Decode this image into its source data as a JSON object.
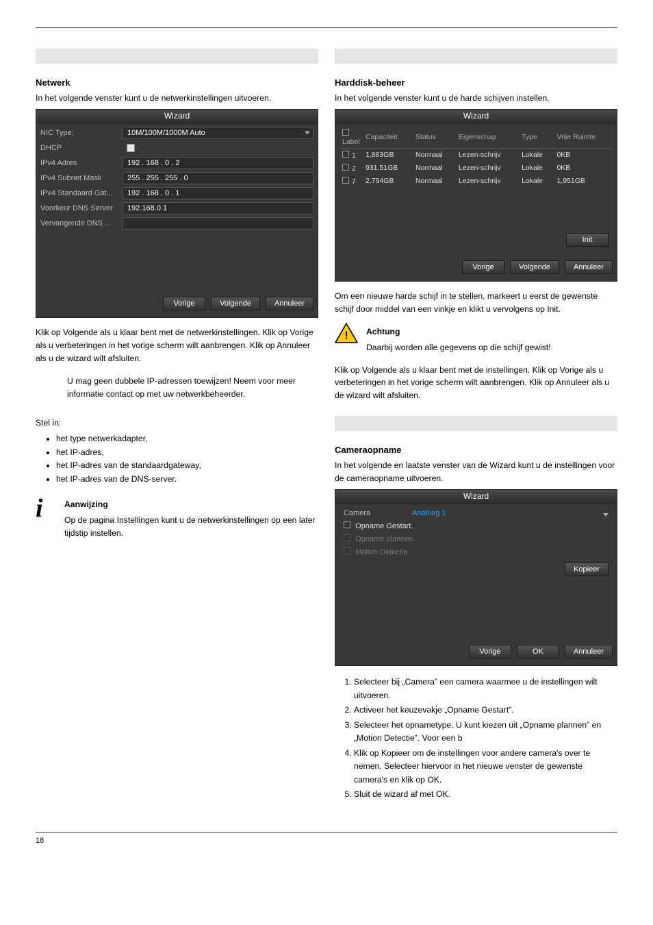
{
  "doc": {
    "section_title": "Netwerk",
    "intro": "In het volgende venster kunt u de netwerkinstellingen uitvoeren.",
    "buttons_para": "Klik op Volgende als u klaar bent met de netwerkinstellingen. Klik op Vorige als u verbeteringen in het vorige scherm wilt aanbrengen. Klik op Annuleer als u de wizard wilt afsluiten.",
    "caution_text": "U mag geen dubbele IP-adressen toewijzen! Neem voor meer informatie contact op met uw netwerkbeheerder.",
    "hdd_section": "Harddisk-beheer",
    "hdd_intro": "In het volgende venster kunt u de harde schijven instellen.",
    "hdd_para": "Om een nieuwe harde schijf in te stellen, markeert u eerst de gewenste schijf door middel van een vinkje en klikt u vervolgens op Init.",
    "hdd_caution": "Daarbij worden alle gegevens op die schijf gewist!",
    "hdd_buttons_para": "Klik op Volgende als u klaar bent met de instellingen. Klik op Vorige als u verbeteringen in het vorige scherm wilt aanbrengen. Klik op Annuleer als u de wizard wilt afsluiten.",
    "nic_label": "NIC Type:",
    "nic_value": "10M/100M/1000M Auto",
    "dhcp_label": "DHCP",
    "ipv4_addr_label": "IPv4 Adres",
    "ipv4_addr_value": "192 . 168 . 0    . 2",
    "ipv4_mask_label": "IPv4 Subnet Mask",
    "ipv4_mask_value": "255 . 255 . 255 . 0",
    "ipv4_gw_label": "IPv4 Standaard Gat...",
    "ipv4_gw_value": "192 . 168 . 0    . 1",
    "dns1_label": "Voorkeur DNS Server",
    "dns1_value": "192.168.0.1",
    "dns2_label": "Vervangende DNS ...",
    "btn_prev": "Vorige",
    "btn_next": "Volgende",
    "btn_cancel": "Annuleer",
    "btn_init": "Init",
    "btn_ok": "OK",
    "btn_kopieer": "Kopieer",
    "wizard_title": "Wizard",
    "hdd_cols": {
      "label": "Label",
      "cap": "Capaciteit",
      "status": "Status",
      "eig": "Eigenschap",
      "type": "Type",
      "vrij": "Vrije Ruimte"
    },
    "hdd_rows": [
      {
        "id": "1",
        "cap": "1,863GB",
        "status": "Normaal",
        "eig": "Lezen-schrijv",
        "type": "Lokale",
        "vrij": "0KB"
      },
      {
        "id": "2",
        "cap": "931.51GB",
        "status": "Normaal",
        "eig": "Lezen-schrijv",
        "type": "Lokale",
        "vrij": "0KB"
      },
      {
        "id": "7",
        "cap": "2,794GB",
        "status": "Normaal",
        "eig": "Lezen-schrijv",
        "type": "Lokale",
        "vrij": "1,951GB"
      }
    ],
    "note_title": "Aanwijzing",
    "note_text": "Op de pagina Instellingen kunt u de netwerkinstellingen op een later tijdstip instellen.",
    "bullets_intro": "Stel in:",
    "bullets": {
      "b0": "het type netwerkadapter,",
      "b1": "het IP-adres,",
      "b2": "het IP-adres van de standaardgateway,",
      "b3": "het IP-adres van de DNS-server."
    },
    "cam_section": "Cameraopname",
    "cam_intro": "In het volgende en laatste venster van de Wizard kunt u de instellingen voor de cameraopname uitvoeren.",
    "rec_camera_label": "Camera",
    "rec_camera_value": "Analoog 1",
    "rec_opname_gestart": "Opname Gestart.",
    "rec_opname_plannen": "Opname plannen",
    "rec_motion": "Motion Detectie",
    "steps": {
      "s1": "Selecteer bij „Camera” een camera waarmee u de instellingen wilt uitvoeren.",
      "s2": "Activeer het keuzevakje „Opname Gestart”.",
      "s3": "Selecteer het opnametype. U kunt kiezen uit „Opname plannen” en „Motion Detectie”. Voor een b",
      "s4": "Klik op Kopieer om de instellingen voor andere camera's over te nemen. Selecteer hiervoor in het nieuwe venster de gewenste camera's en klik op OK.",
      "s5": "Sluit de wizard af met OK."
    },
    "footer": "18"
  }
}
